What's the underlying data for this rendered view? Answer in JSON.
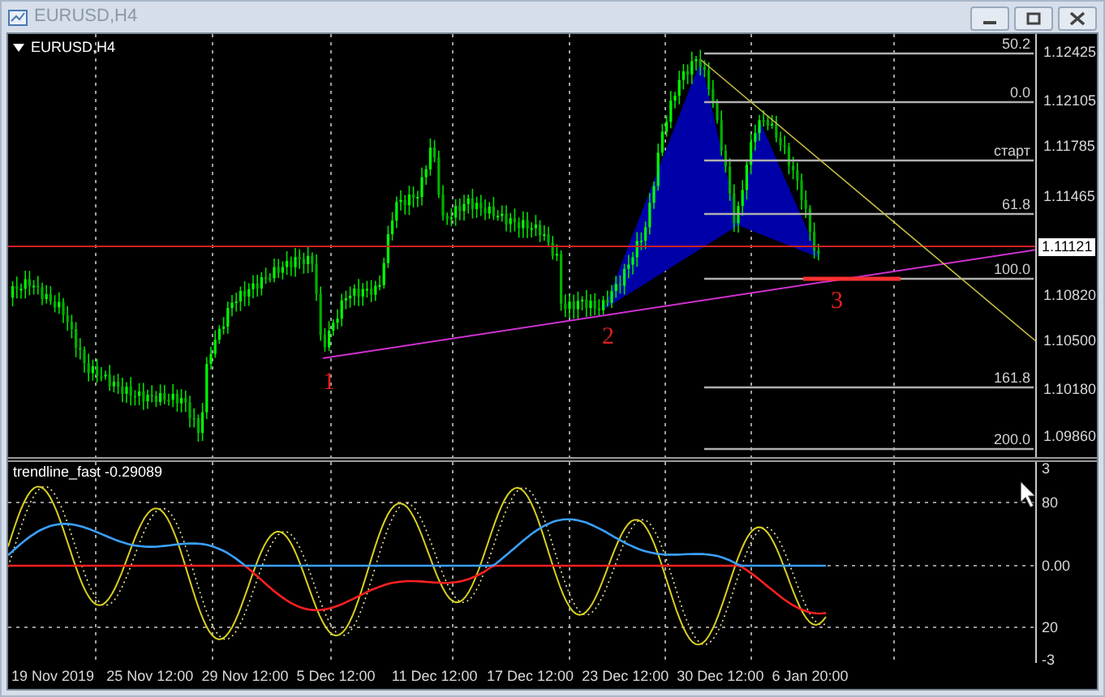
{
  "window": {
    "title": "EURUSD,H4"
  },
  "chart": {
    "symbol_label": "EURUSD,H4",
    "price_axis": [
      "1.12425",
      "1.12105",
      "1.11785",
      "1.11465",
      "1.10820",
      "1.10500",
      "1.10180",
      "1.09860"
    ],
    "current_price": "1.11121",
    "fib_levels": [
      "50.2",
      "0.0",
      "старт",
      "61.8",
      "100.0",
      "161.8",
      "200.0"
    ],
    "wave_labels": [
      "1",
      "2",
      "3"
    ]
  },
  "indicator": {
    "label": "trendline_fast -0.29089",
    "axis": [
      "3",
      "80",
      "0.00",
      "20",
      "-3"
    ]
  },
  "time_axis": [
    "19 Nov 2019",
    "25 Nov 12:00",
    "29 Nov 12:00",
    "5 Dec 12:00",
    "11 Dec 12:00",
    "17 Dec 12:00",
    "23 Dec 12:00",
    "30 Dec 12:00",
    "6 Jan 20:00"
  ]
}
